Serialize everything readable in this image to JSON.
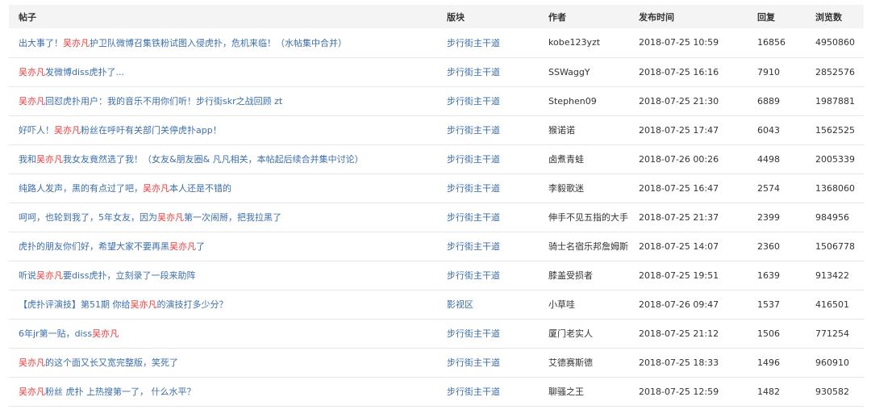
{
  "headers": [
    "帖子",
    "版块",
    "作者",
    "发布时间",
    "回复",
    "浏览数"
  ],
  "colors": {
    "title_link": "#3c6ea8",
    "highlight": "#e03a3a",
    "header_bg": "#f4f4f4"
  },
  "rows": [
    {
      "title": [
        {
          "t": "出大事了！",
          "hl": false
        },
        {
          "t": "吴亦凡",
          "hl": true
        },
        {
          "t": "护卫队微博召集铁粉试图入侵虎扑，危机来临！（水帖集中合并）",
          "hl": false
        }
      ],
      "forum": "步行街主干道",
      "author": "kobe123yzt",
      "time": "2018-07-25 10:59",
      "replies": "16856",
      "views": "4950860"
    },
    {
      "title": [
        {
          "t": "吴亦凡",
          "hl": true
        },
        {
          "t": "发微博diss虎扑了...",
          "hl": false
        }
      ],
      "forum": "步行街主干道",
      "author": "SSWaggY",
      "time": "2018-07-25 16:16",
      "replies": "7910",
      "views": "2852576"
    },
    {
      "title": [
        {
          "t": "吴亦凡",
          "hl": true
        },
        {
          "t": "回怼虎扑用户：我的音乐不用你们听！步行街skr之战回顾 zt",
          "hl": false
        }
      ],
      "forum": "步行街主干道",
      "author": "Stephen09",
      "time": "2018-07-25 21:30",
      "replies": "6889",
      "views": "1987881"
    },
    {
      "title": [
        {
          "t": "好吓人！",
          "hl": false
        },
        {
          "t": "吴亦凡",
          "hl": true
        },
        {
          "t": "粉丝在呼吁有关部门关停虎扑app！",
          "hl": false
        }
      ],
      "forum": "步行街主干道",
      "author": "猴诺诺",
      "time": "2018-07-25 17:47",
      "replies": "6043",
      "views": "1562525"
    },
    {
      "title": [
        {
          "t": "我和",
          "hl": false
        },
        {
          "t": "吴亦凡",
          "hl": true
        },
        {
          "t": "我女友竟然选了我！（女友&朋友圈& 凡凡相关，本帖起后续合并集中讨论）",
          "hl": false
        }
      ],
      "forum": "步行街主干道",
      "author": "卤煮青蛙",
      "time": "2018-07-26 00:26",
      "replies": "4498",
      "views": "2005339"
    },
    {
      "title": [
        {
          "t": "纯路人发声，黑的有点过了吧，",
          "hl": false
        },
        {
          "t": "吴亦凡",
          "hl": true
        },
        {
          "t": "本人还是不错的",
          "hl": false
        }
      ],
      "forum": "步行街主干道",
      "author": "李毅歌迷",
      "time": "2018-07-25 16:47",
      "replies": "2574",
      "views": "1368060"
    },
    {
      "title": [
        {
          "t": "呵呵，也轮到我了，5年女友，因为",
          "hl": false
        },
        {
          "t": "吴亦凡",
          "hl": true
        },
        {
          "t": "第一次闹掰，把我拉黑了",
          "hl": false
        }
      ],
      "forum": "步行街主干道",
      "author": "伸手不见五指的大手",
      "time": "2018-07-25 21:37",
      "replies": "2399",
      "views": "984956"
    },
    {
      "title": [
        {
          "t": "虎扑的朋友你们好，希望大家不要再黑",
          "hl": false
        },
        {
          "t": "吴亦凡",
          "hl": true
        },
        {
          "t": "了",
          "hl": false
        }
      ],
      "forum": "步行街主干道",
      "author": "骑士名宿乐邦詹姆斯",
      "time": "2018-07-25 14:07",
      "replies": "2360",
      "views": "1506778"
    },
    {
      "title": [
        {
          "t": "听说",
          "hl": false
        },
        {
          "t": "吴亦凡",
          "hl": true
        },
        {
          "t": "要diss虎扑，立刻录了一段来助阵",
          "hl": false
        }
      ],
      "forum": "步行街主干道",
      "author": "膝盖受损者",
      "time": "2018-07-25 19:51",
      "replies": "1639",
      "views": "913422"
    },
    {
      "title": [
        {
          "t": "【虎扑评演技】第51期 你给",
          "hl": false
        },
        {
          "t": "吴亦凡",
          "hl": true
        },
        {
          "t": "的演技打多少分？",
          "hl": false
        }
      ],
      "forum": "影视区",
      "author": "小草哇",
      "time": "2018-07-26 09:47",
      "replies": "1537",
      "views": "416501"
    },
    {
      "title": [
        {
          "t": "6年jr第一贴，diss",
          "hl": false
        },
        {
          "t": "吴亦凡",
          "hl": true
        }
      ],
      "forum": "步行街主干道",
      "author": "厦门老实人",
      "time": "2018-07-25 21:12",
      "replies": "1506",
      "views": "771254"
    },
    {
      "title": [
        {
          "t": "吴亦凡",
          "hl": true
        },
        {
          "t": "的这个面又长又宽完整版，笑死了",
          "hl": false
        }
      ],
      "forum": "步行街主干道",
      "author": "艾德赛斯德",
      "time": "2018-07-25 18:33",
      "replies": "1496",
      "views": "960910"
    },
    {
      "title": [
        {
          "t": "吴亦凡",
          "hl": true
        },
        {
          "t": "粉丝 虎扑 上热搜第一了， 什么水平？",
          "hl": false
        }
      ],
      "forum": "步行街主干道",
      "author": "聊骚之王",
      "time": "2018-07-25 12:59",
      "replies": "1482",
      "views": "930582"
    }
  ]
}
